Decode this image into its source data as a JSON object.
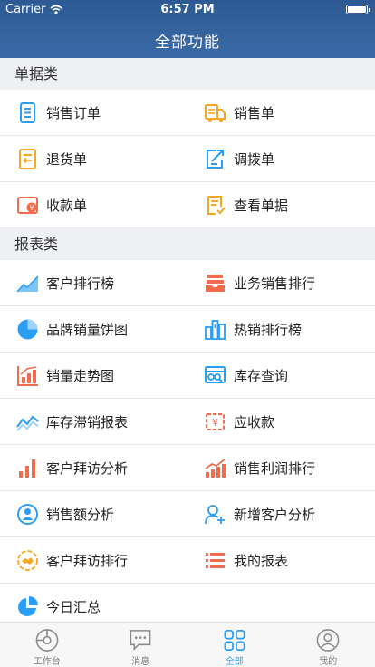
{
  "status": {
    "carrier": "Carrier",
    "time": "6:57 PM"
  },
  "nav": {
    "title": "全部功能"
  },
  "sections": [
    {
      "title": "单据类",
      "rows": [
        [
          {
            "label": "销售订单",
            "icon": "sales-order-icon",
            "color": "#2a9df4"
          },
          {
            "label": "销售单",
            "icon": "sales-slip-icon",
            "color": "#f5a623"
          }
        ],
        [
          {
            "label": "退货单",
            "icon": "return-slip-icon",
            "color": "#f5a623"
          },
          {
            "label": "调拨单",
            "icon": "transfer-slip-icon",
            "color": "#2a9df4"
          }
        ],
        [
          {
            "label": "收款单",
            "icon": "receipt-slip-icon",
            "color": "#f26b4d"
          },
          {
            "label": "查看单据",
            "icon": "view-documents-icon",
            "color": "#f5a623"
          }
        ]
      ]
    },
    {
      "title": "报表类",
      "rows": [
        [
          {
            "label": "客户排行榜",
            "icon": "customer-ranking-icon",
            "color": "#2a9df4"
          },
          {
            "label": "业务销售排行",
            "icon": "business-sales-ranking-icon",
            "color": "#f26b4d"
          }
        ],
        [
          {
            "label": "品牌销量饼图",
            "icon": "brand-pie-chart-icon",
            "color": "#2a9df4"
          },
          {
            "label": "热销排行榜",
            "icon": "hot-sales-ranking-icon",
            "color": "#2a9df4"
          }
        ],
        [
          {
            "label": "销量走势图",
            "icon": "sales-trend-icon",
            "color": "#f26b4d"
          },
          {
            "label": "库存查询",
            "icon": "inventory-query-icon",
            "color": "#2a9df4"
          }
        ],
        [
          {
            "label": "库存滞销报表",
            "icon": "slow-moving-stock-icon",
            "color": "#2a9df4"
          },
          {
            "label": "应收款",
            "icon": "receivables-icon",
            "color": "#f26b4d"
          }
        ],
        [
          {
            "label": "客户拜访分析",
            "icon": "customer-visit-analysis-icon",
            "color": "#f26b4d"
          },
          {
            "label": "销售利润排行",
            "icon": "sales-profit-ranking-icon",
            "color": "#f26b4d"
          }
        ],
        [
          {
            "label": "销售额分析",
            "icon": "sales-amount-analysis-icon",
            "color": "#2a9df4"
          },
          {
            "label": "新增客户分析",
            "icon": "new-customer-analysis-icon",
            "color": "#2a9df4"
          }
        ],
        [
          {
            "label": "客户拜访排行",
            "icon": "customer-visit-ranking-icon",
            "color": "#f5a623"
          },
          {
            "label": "我的报表",
            "icon": "my-reports-icon",
            "color": "#f26b4d"
          }
        ],
        [
          {
            "label": "今日汇总",
            "icon": "today-summary-icon",
            "color": "#2a9df4"
          }
        ]
      ]
    }
  ],
  "tabbar": [
    {
      "label": "工作台",
      "icon": "workbench-icon",
      "active": false
    },
    {
      "label": "消息",
      "icon": "message-icon",
      "active": false
    },
    {
      "label": "全部",
      "icon": "all-apps-icon",
      "active": true
    },
    {
      "label": "我的",
      "icon": "profile-icon",
      "active": false
    }
  ],
  "colors": {
    "nav_bg": "#3a6aa6",
    "active_tab": "#2a9df4",
    "accent_blue": "#2a9df4",
    "accent_orange": "#f5a623",
    "accent_red": "#f26b4d"
  }
}
